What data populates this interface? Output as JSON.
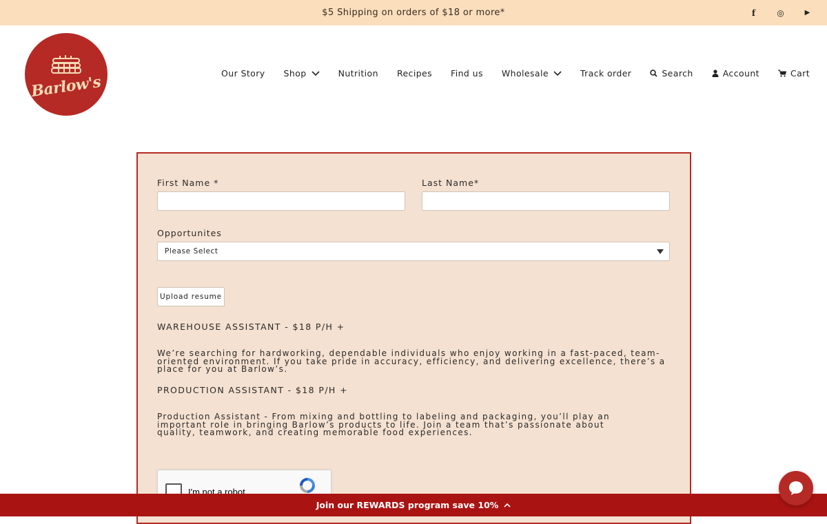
{
  "announcement": {
    "text": "$5 Shipping on orders of $18 or more*"
  },
  "social": {
    "icons": [
      "facebook-icon",
      "instagram-icon",
      "youtube-icon"
    ],
    "facebook_glyph": "f",
    "instagram_glyph": "◎",
    "youtube_glyph": "▶"
  },
  "brand": {
    "logo_text": "Barlow's",
    "logo_color": "#b52a25"
  },
  "nav": {
    "our_story": "Our Story",
    "shop": "Shop",
    "nutrition": "Nutrition",
    "recipes": "Recipes",
    "find_us": "Find us",
    "wholesale": "Wholesale",
    "track_order": "Track order",
    "search": "Search",
    "account": "Account",
    "cart": "Cart"
  },
  "form": {
    "first_name_label": "First Name *",
    "first_name_value": "",
    "last_name_label": "Last Name*",
    "last_name_value": "",
    "opportunities_label": "Opportunites",
    "opportunities_selected": "Please Select",
    "upload_label": "Upload resume",
    "jobs": [
      {
        "title": "WAREHOUSE ASSISTANT - $18 P/H +",
        "description": "We’re searching for hardworking, dependable individuals who enjoy working in a fast-paced, team-oriented environment. If you take pride in accuracy, efficiency, and delivering excellence, there’s a place for you at Barlow’s."
      },
      {
        "title": "PRODUCTION ASSISTANT - $18 P/H +",
        "description": "Production Assistant - From mixing and bottling to labeling and packaging, you’ll play an important role in bringing Barlow’s products to life. Join a team that’s passionate about quality, teamwork, and creating memorable food experiences."
      }
    ],
    "captcha_label": "I'm not a robot",
    "border_color": "#b52a25",
    "background_color": "#f5e1d1"
  },
  "rewards": {
    "text": "Join our REWARDS program save 10%",
    "color": "#a91412"
  },
  "chat": {
    "icon": "chat-bubble-icon"
  }
}
